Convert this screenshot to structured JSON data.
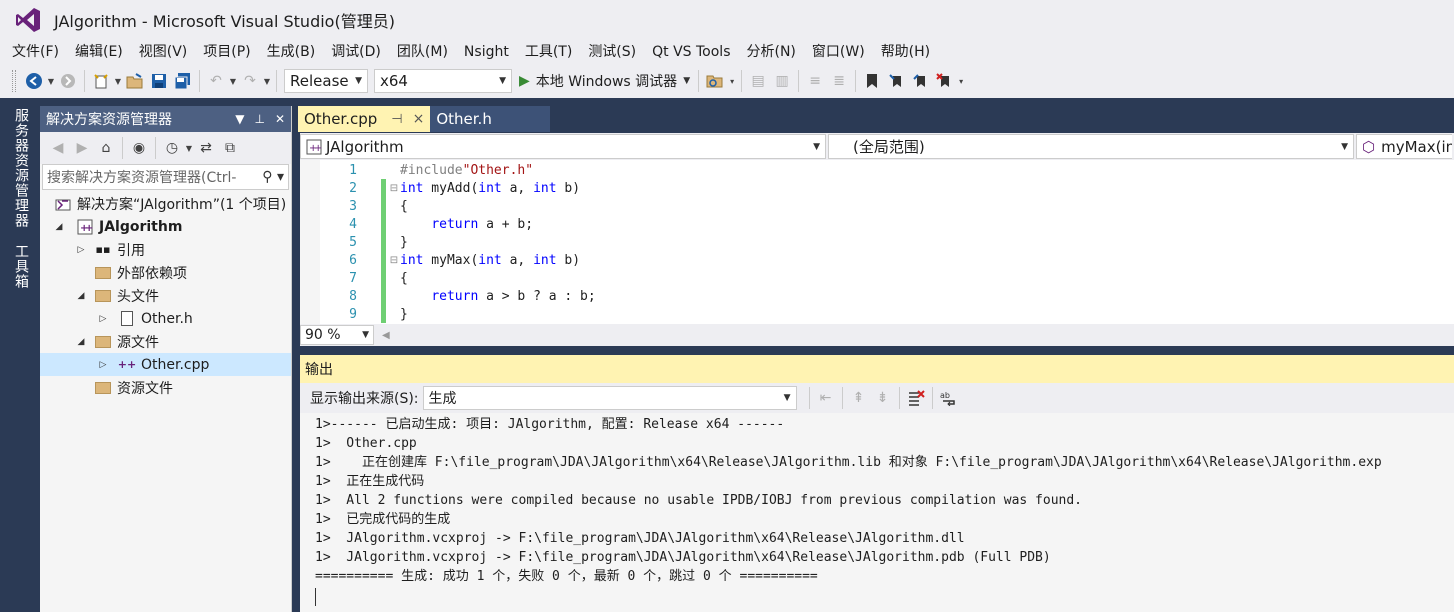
{
  "window": {
    "title": "JAlgorithm - Microsoft Visual Studio(管理员)"
  },
  "menu": [
    "文件(F)",
    "编辑(E)",
    "视图(V)",
    "项目(P)",
    "生成(B)",
    "调试(D)",
    "团队(M)",
    "Nsight",
    "工具(T)",
    "测试(S)",
    "Qt VS Tools",
    "分析(N)",
    "窗口(W)",
    "帮助(H)"
  ],
  "toolbar": {
    "configuration": "Release",
    "platform": "x64",
    "debugger": "本地 Windows 调试器"
  },
  "side_tabs": {
    "server_explorer": "服务器资源管理器",
    "toolbox": "工具箱"
  },
  "solution_explorer": {
    "title": "解决方案资源管理器",
    "search_placeholder": "搜索解决方案资源管理器(Ctrl-",
    "items": [
      {
        "label": "解决方案“JAlgorithm”(1 个项目)"
      },
      {
        "label": "JAlgorithm"
      },
      {
        "label": "引用"
      },
      {
        "label": "外部依赖项"
      },
      {
        "label": "头文件"
      },
      {
        "label": "Other.h"
      },
      {
        "label": "源文件"
      },
      {
        "label": "Other.cpp"
      },
      {
        "label": "资源文件"
      }
    ]
  },
  "tabs": [
    {
      "label": "Other.cpp",
      "pin": "⊣",
      "close": "×"
    },
    {
      "label": "Other.h"
    }
  ],
  "navigation": {
    "project": "JAlgorithm",
    "scope": "(全局范围)",
    "member": "myMax(in"
  },
  "editor": {
    "line_numbers": [
      "1",
      "2",
      "3",
      "4",
      "5",
      "6",
      "7",
      "8",
      "9"
    ],
    "zoom": "90 %"
  },
  "output": {
    "title": "输出",
    "source_label": "显示输出来源(S):",
    "source_value": "生成",
    "lines": [
      "1>------ 已启动生成: 项目: JAlgorithm, 配置: Release x64 ------",
      "1>  Other.cpp",
      "1>    正在创建库 F:\\file_program\\JDA\\JAlgorithm\\x64\\Release\\JAlgorithm.lib 和对象 F:\\file_program\\JDA\\JAlgorithm\\x64\\Release\\JAlgorithm.exp",
      "1>  正在生成代码",
      "1>  All 2 functions were compiled because no usable IPDB/IOBJ from previous compilation was found.",
      "1>  已完成代码的生成",
      "1>  JAlgorithm.vcxproj -> F:\\file_program\\JDA\\JAlgorithm\\x64\\Release\\JAlgorithm.dll",
      "1>  JAlgorithm.vcxproj -> F:\\file_program\\JDA\\JAlgorithm\\x64\\Release\\JAlgorithm.pdb (Full PDB)",
      "========== 生成: 成功 1 个，失败 0 个，最新 0 个，跳过 0 个 =========="
    ]
  }
}
